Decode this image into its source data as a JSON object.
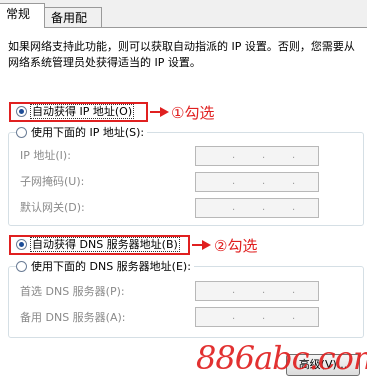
{
  "tabs": [
    {
      "label": "常规"
    },
    {
      "label": "备用配置"
    }
  ],
  "description": "如果网络支持此功能，则可以获取自动指派的 IP 设置。否则，您需要从网络系统管理员处获得适当的 IP 设置。",
  "ip": {
    "auto_label": "自动获得 IP 地址(O)",
    "manual_label": "使用下面的 IP 地址(S):",
    "fields": [
      {
        "label": "IP 地址(I):"
      },
      {
        "label": "子网掩码(U):"
      },
      {
        "label": "默认网关(D):"
      }
    ]
  },
  "dns": {
    "auto_label": "自动获得 DNS 服务器地址(B)",
    "manual_label": "使用下面的 DNS 服务器地址(E):",
    "fields": [
      {
        "label": "首选 DNS 服务器(P):"
      },
      {
        "label": "备用 DNS 服务器(A):"
      }
    ]
  },
  "annotations": {
    "step1": "①勾选",
    "step2": "②勾选"
  },
  "advanced_label": "高级(V)...",
  "watermark": "886abc.com",
  "colors": {
    "annotation": "#e02020",
    "radio_selected": "#1c4d97"
  }
}
